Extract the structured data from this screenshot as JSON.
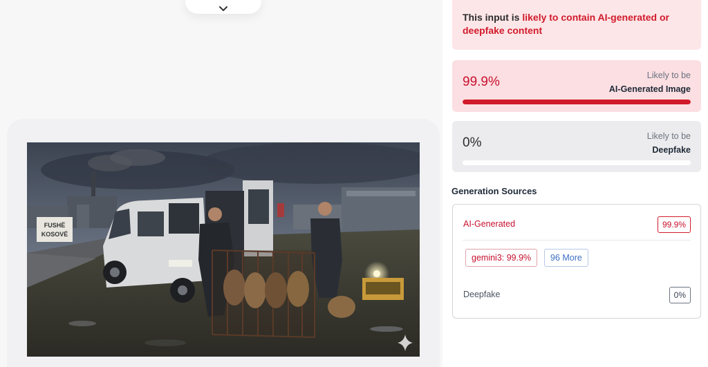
{
  "collapse": {
    "icon": "chevron-down-icon"
  },
  "image": {
    "watermark_icon": "sparkle-icon"
  },
  "verdict": {
    "prefix": "This input is ",
    "highlight": "likely to contain AI-generated or deepfake content"
  },
  "scores": {
    "ai": {
      "value": "99.9%",
      "fraction": 0.999,
      "label_top": "Likely to be",
      "label_bottom": "AI-Generated Image",
      "bar_color": "#d11a2a"
    },
    "deepfake": {
      "value": "0%",
      "fraction": 0,
      "label_top": "Likely to be",
      "label_bottom": "Deepfake",
      "bar_color": "#d11a2a"
    }
  },
  "sources": {
    "heading": "Generation Sources",
    "ai": {
      "title": "AI-Generated",
      "score": "99.9%",
      "models": [
        {
          "label": "gemini3: 99.9%"
        }
      ],
      "more": "96 More"
    },
    "deepfake": {
      "title": "Deepfake",
      "score": "0%"
    }
  },
  "colors": {
    "accent_red": "#d11a2a",
    "link_blue": "#3b6fc4"
  }
}
